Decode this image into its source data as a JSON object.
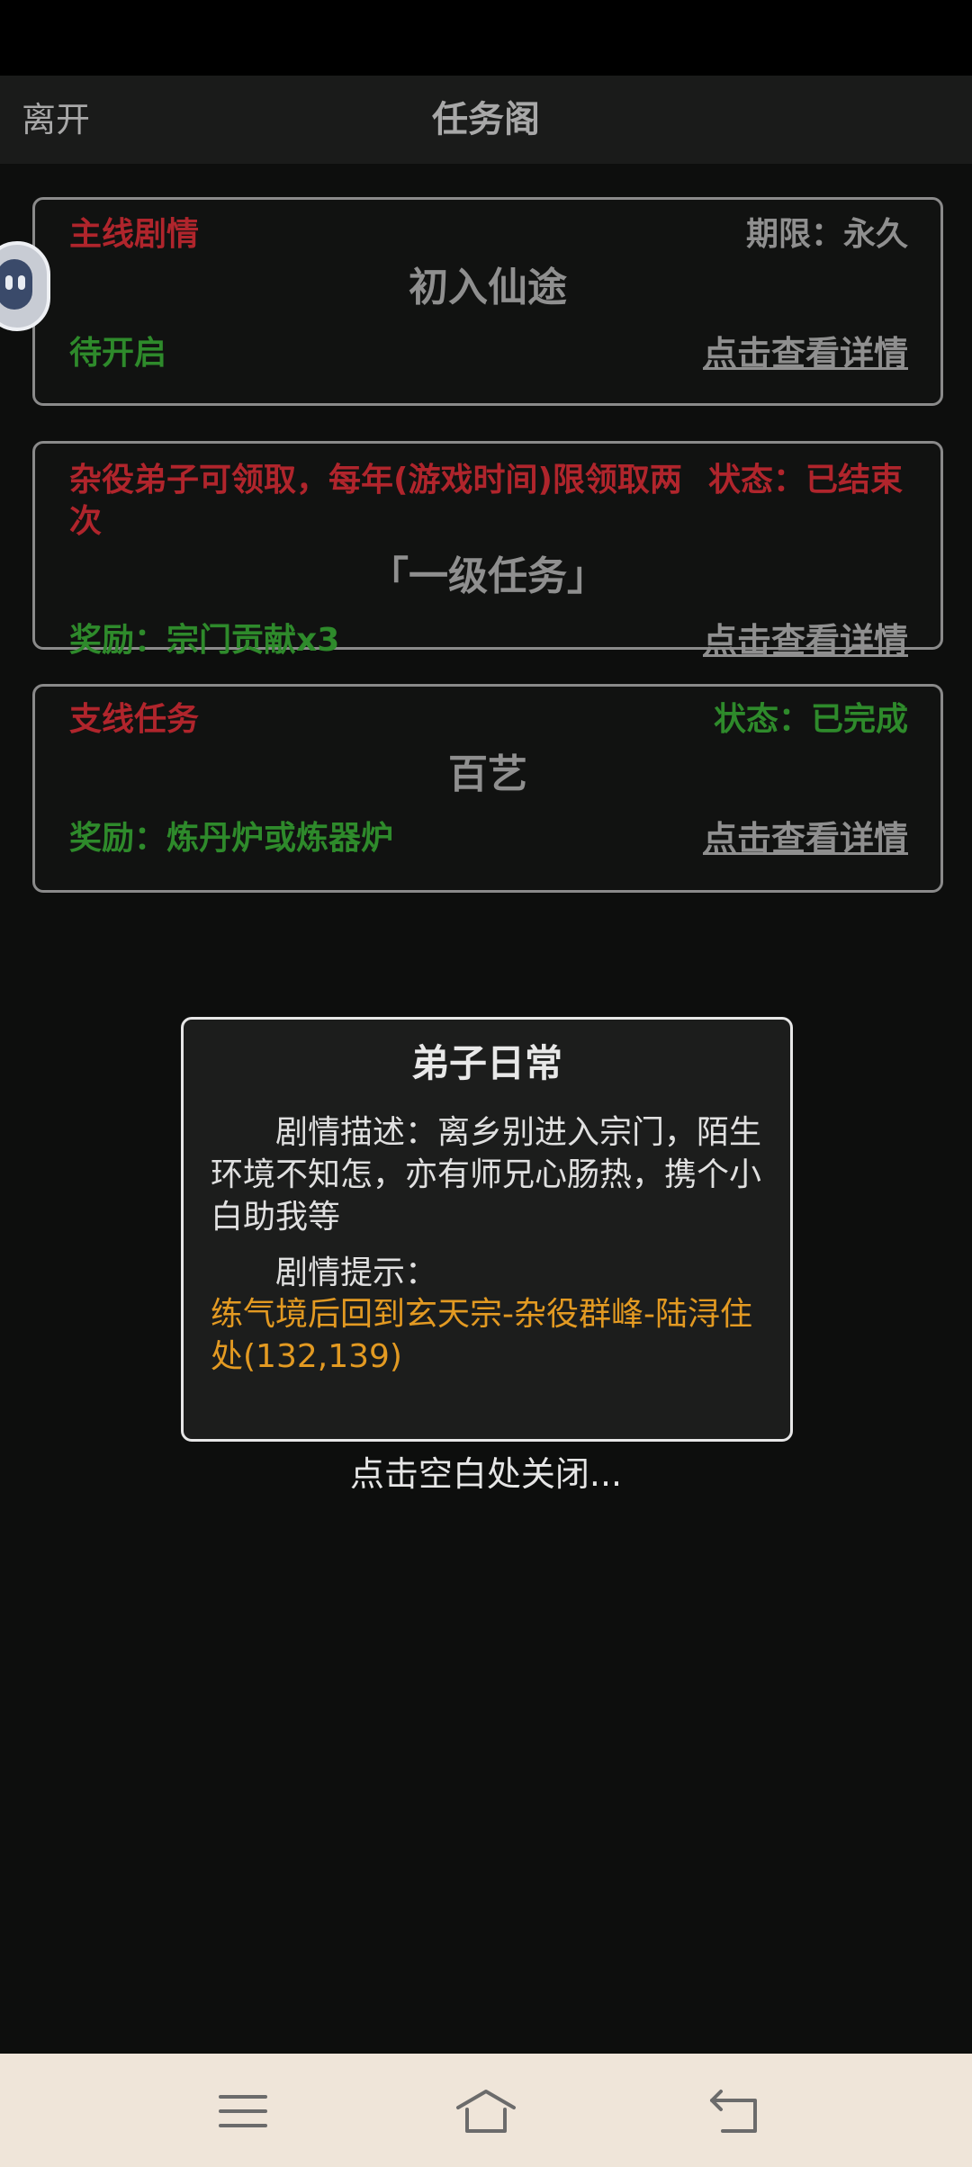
{
  "header": {
    "leave_label": "离开",
    "title": "任务阁"
  },
  "tasks": [
    {
      "category": "主线剧情",
      "meta": "期限：永久",
      "name": "初入仙途",
      "bottom_left": "待开启",
      "detail_label": "点击查看详情"
    },
    {
      "category": "杂役弟子可领取，每年(游戏时间)限领取两次",
      "meta": "状态：已结束",
      "name": "「一级任务」",
      "bottom_left": "奖励：宗门贡献x3",
      "detail_label": "点击查看详情"
    },
    {
      "category": "支线任务",
      "meta": "状态：已完成",
      "name": "百艺",
      "bottom_left": "奖励：炼丹炉或炼器炉",
      "detail_label": "点击查看详情"
    }
  ],
  "modal": {
    "title": "弟子日常",
    "description": "剧情描述：离乡别进入宗门，陌生环境不知怎，亦有师兄心肠热，携个小白助我等",
    "hint_label": "剧情提示：",
    "hint": "练气境后回到玄天宗-杂役群峰-陆浔住处(132,139)",
    "close_hint": "点击空白处关闭..."
  },
  "colors": {
    "accent_red": "#b0252c",
    "accent_green": "#2e8a2b",
    "hint_orange": "#e39a22",
    "muted_grey": "#8f8f8f"
  },
  "icons": {
    "float_ball": "assistant-float-icon",
    "nav_menu": "menu-icon",
    "nav_home": "home-icon",
    "nav_back": "back-icon"
  }
}
